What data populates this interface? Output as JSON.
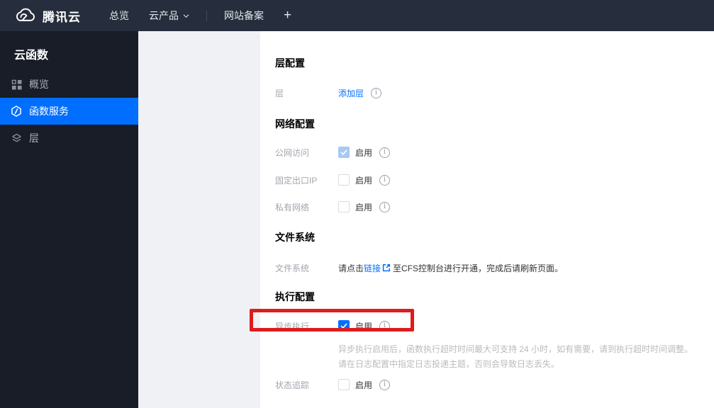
{
  "colors": {
    "accent": "#006eff",
    "navbar_bg": "#262e3d",
    "sidebar_bg": "#181d27",
    "highlight_red": "#de1c1c",
    "disabled_check": "#a7c9f2"
  },
  "navbar": {
    "brand": "腾讯云",
    "items": [
      {
        "label": "总览"
      },
      {
        "label": "云产品"
      },
      {
        "label": "网站备案"
      },
      {
        "label": "+"
      }
    ]
  },
  "sidebar": {
    "title": "云函数",
    "items": [
      {
        "label": "概览",
        "icon": "grid-icon",
        "active": false
      },
      {
        "label": "函数服务",
        "icon": "hexagon-function-icon",
        "active": true
      },
      {
        "label": "层",
        "icon": "layers-icon",
        "active": false
      }
    ]
  },
  "main": {
    "layer_section": {
      "title": "层配置",
      "row": {
        "label": "层",
        "link": "添加层"
      }
    },
    "network_section": {
      "title": "网络配置",
      "rows": [
        {
          "label": "公网访问",
          "enable": "启用",
          "state": "checked-disabled"
        },
        {
          "label": "固定出口IP",
          "enable": "启用",
          "state": "unchecked"
        },
        {
          "label": "私有网络",
          "enable": "启用",
          "state": "unchecked"
        }
      ]
    },
    "filesystem_section": {
      "title": "文件系统",
      "row": {
        "label": "文件系统",
        "text_before": "请点击",
        "link": "链接",
        "text_after": "至CFS控制台进行开通，完成后请刷新页面。"
      }
    },
    "execution_section": {
      "title": "执行配置",
      "async_row": {
        "label": "异步执行",
        "enable": "启用",
        "state": "checked"
      },
      "description_line1": "异步执行启用后，函数执行超时时间最大可支持 24 小时，如有需要，请到执行超时时间调整。",
      "description_line2": "请在日志配置中指定日志投递主题，否则会导致日志丢失。",
      "trace_row": {
        "label": "状态追踪",
        "enable": "启用",
        "state": "unchecked"
      }
    }
  }
}
